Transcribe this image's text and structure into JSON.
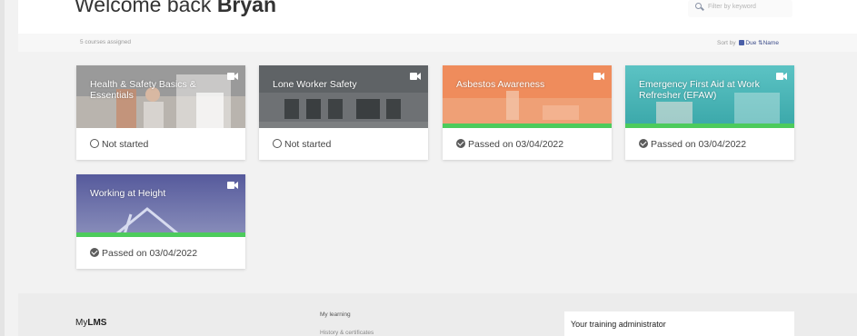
{
  "header": {
    "welcome_lead": "Welcome back",
    "welcome_name": "Bryan",
    "search_placeholder": "Filter by keyword"
  },
  "subbar": {
    "assigned_count": "5 courses assigned",
    "sort_label": "Sort by",
    "sort_due": "Due",
    "sort_arrows": "⇅",
    "sort_name": "Name"
  },
  "courses": [
    {
      "title": "Health & Safety Basics & Essentials",
      "status": "Not started",
      "status_icon": "circle-outline-icon",
      "progress": 0,
      "theme": "#8f8f8f"
    },
    {
      "title": "Lone Worker Safety",
      "status": "Not started",
      "status_icon": "circle-outline-icon",
      "progress": 0,
      "theme": "#6f7274"
    },
    {
      "title": "Asbestos Awareness",
      "status": "Passed on 03/04/2022",
      "status_icon": "check-circle-icon",
      "progress": 1,
      "theme": "#ef8a5a"
    },
    {
      "title": "Emergency First Aid at Work Refresher (EFAW)",
      "status": "Passed on 03/04/2022",
      "status_icon": "check-circle-icon",
      "progress": 1,
      "theme": "#5fc1c2"
    },
    {
      "title": "Working at Height",
      "status": "Passed on 03/04/2022",
      "status_icon": "check-circle-icon",
      "progress": 1,
      "theme": "#5b5f9e"
    }
  ],
  "footer": {
    "brand_prefix": "My",
    "brand_bold": "LMS",
    "link_my_learning": "My learning",
    "link_history": "History & certificates",
    "admin_title": "Your training administrator"
  },
  "colors": {
    "progress_green": "#4ccb5c",
    "accent_blue": "#3c4c8a"
  }
}
